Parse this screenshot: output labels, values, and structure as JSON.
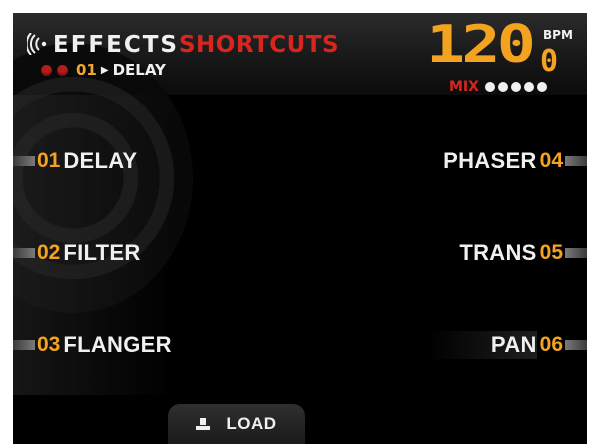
{
  "header": {
    "title_main": "EFFECTS",
    "title_accent": "SHORTCUTS",
    "current_number": "01",
    "current_name": "DELAY"
  },
  "bpm": {
    "value": "120",
    "decimal": "0",
    "unit": "BPM",
    "mix_label": "MIX",
    "mix_level_dots": 5
  },
  "effects": {
    "left": [
      {
        "number": "01",
        "name": "DELAY"
      },
      {
        "number": "02",
        "name": "FILTER"
      },
      {
        "number": "03",
        "name": "FLANGER"
      }
    ],
    "right": [
      {
        "number": "04",
        "name": "PHASER"
      },
      {
        "number": "05",
        "name": "TRANS"
      },
      {
        "number": "06",
        "name": "PAN"
      }
    ]
  },
  "footer": {
    "load_label": "LOAD"
  },
  "colors": {
    "accent_orange": "#f4a321",
    "accent_red": "#d8261f",
    "text_white": "#f0f0f0",
    "background": "#000000"
  },
  "icons": {
    "header_icon": "wireless-signal-icon",
    "load_icon": "load-arrow-icon",
    "breadcrumb_arrow": "play-arrow-icon"
  }
}
